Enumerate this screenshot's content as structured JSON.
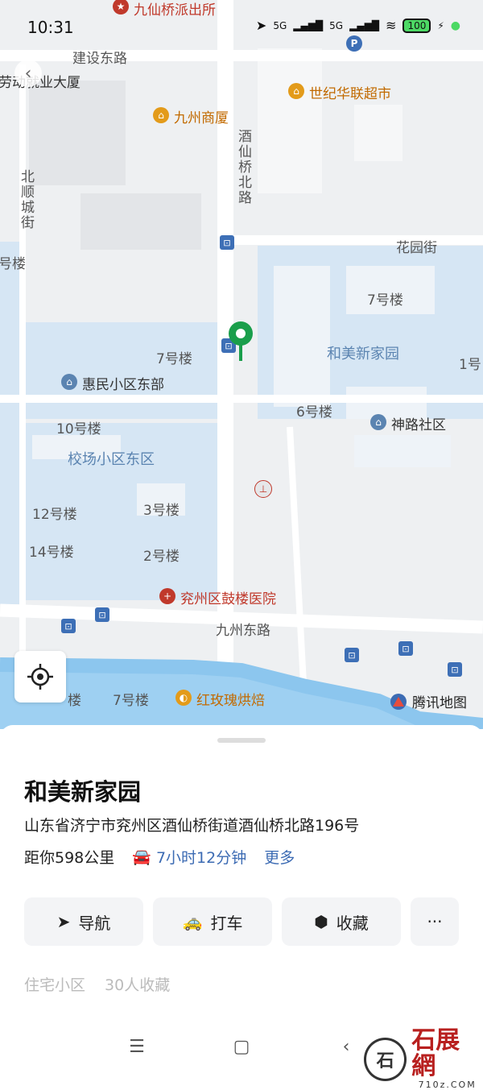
{
  "status": {
    "time": "10:31",
    "network1": "5G",
    "network2": "5G",
    "battery": "100"
  },
  "map": {
    "labels": {
      "police": "九仙桥派出所",
      "road_jianshe": "建设东路",
      "labor_building": "劳动就业大厦",
      "supermarket": "世纪华联超市",
      "jiuzhou_mall": "九州商厦",
      "jiuxianqiao_rd": "酒仙桥北路",
      "beishun_st": "北顺城街",
      "huayuan_st": "花园街",
      "bldg7_right": "7号楼",
      "bldg7_left": "7号楼",
      "hemei": "和美新家园",
      "bldg1": "1号",
      "huimin": "惠民小区东部",
      "bldg6": "6号楼",
      "shenlu": "神路社区",
      "bldg10": "10号楼",
      "xiaochang": "校场小区东区",
      "bldg12": "12号楼",
      "bldg3": "3号楼",
      "bldg14": "14号楼",
      "bldg2": "2号楼",
      "hospital": "兖州区鼓楼医院",
      "jiuzhou_east": "九州东路",
      "bldg7_bottom": "7号楼",
      "bldg_bottom_left": "楼",
      "hongmeigui": "红玫瑰烘焙",
      "left_edge_bldg": "号楼"
    },
    "brand": "腾讯地图",
    "accent_color": "#1a9e4b"
  },
  "place": {
    "title": "和美新家园",
    "address": "山东省济宁市兖州区酒仙桥街道酒仙桥北路196号",
    "distance": "距你598公里",
    "drive_time": "7小时12分钟",
    "more": "更多"
  },
  "actions": [
    {
      "label": "导航",
      "icon": "navigate-icon"
    },
    {
      "label": "打车",
      "icon": "taxi-icon"
    },
    {
      "label": "收藏",
      "icon": "favorite-icon"
    },
    {
      "label": "···",
      "icon": "more-icon"
    }
  ],
  "tags": [
    "住宅小区",
    "30人收藏"
  ],
  "watermark": {
    "circle": "石",
    "brand": "石展網",
    "site": "710z.COM"
  }
}
